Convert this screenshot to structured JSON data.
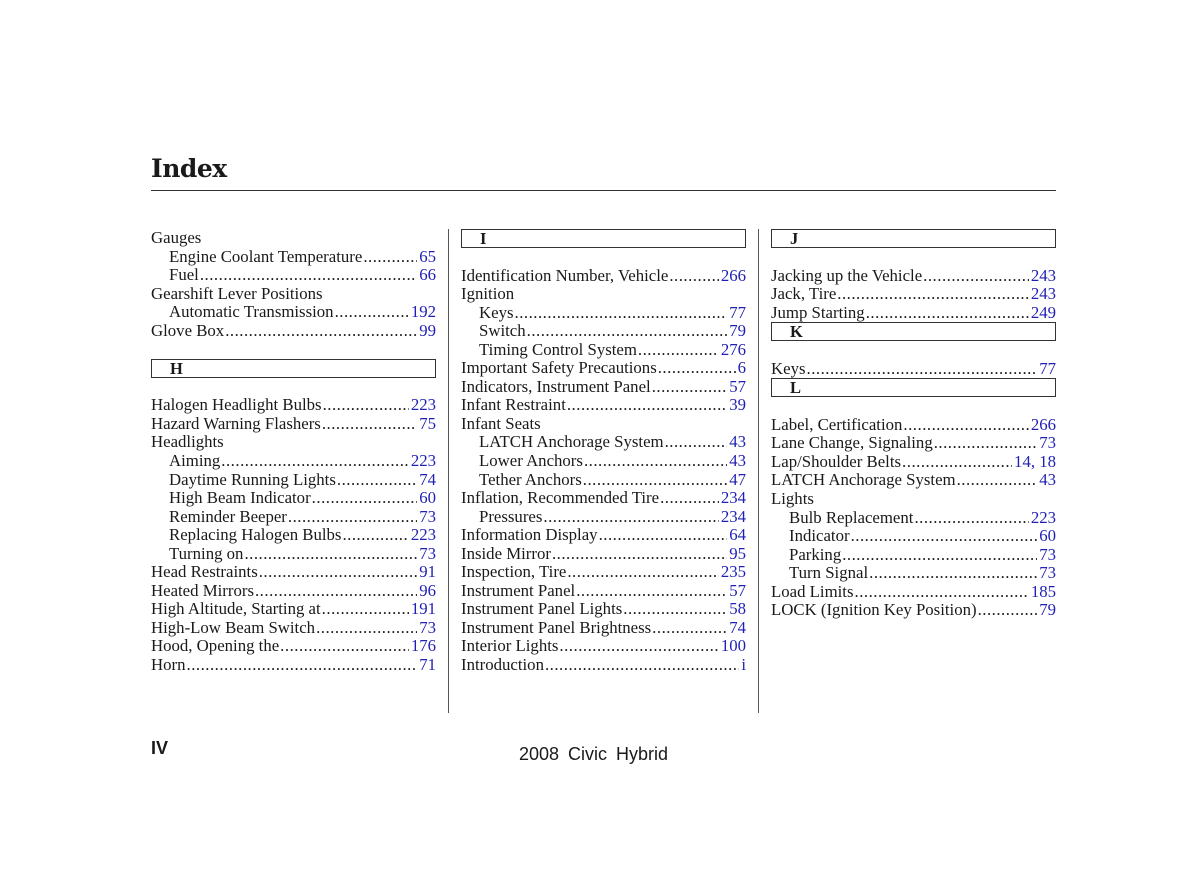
{
  "title": "Index",
  "footer": {
    "page_number": "IV",
    "publication": "2008  Civic  Hybrid"
  },
  "colors": {
    "page_link": "#1f1fb4",
    "text": "#1a1a1a"
  },
  "columns": [
    {
      "blocks": [
        {
          "type": "entry",
          "label": "Gauges",
          "page": "",
          "level": 0
        },
        {
          "type": "entry",
          "label": "Engine Coolant Temperature",
          "page": "65",
          "level": 1
        },
        {
          "type": "entry",
          "label": "Fuel",
          "page": "66",
          "level": 1
        },
        {
          "type": "entry",
          "label": "Gearshift Lever Positions",
          "page": "",
          "level": 0
        },
        {
          "type": "entry",
          "label": "Automatic Transmission",
          "page": "192",
          "level": 1
        },
        {
          "type": "entry",
          "label": "Glove Box",
          "page": "99",
          "level": 0
        },
        {
          "type": "gap"
        },
        {
          "type": "header",
          "letter": "H"
        },
        {
          "type": "entry",
          "label": "Halogen Headlight Bulbs",
          "page": "223",
          "level": 0
        },
        {
          "type": "entry",
          "label": "Hazard Warning Flashers",
          "page": "75",
          "level": 0
        },
        {
          "type": "entry",
          "label": "Headlights",
          "page": "",
          "level": 0
        },
        {
          "type": "entry",
          "label": "Aiming",
          "page": "223",
          "level": 1
        },
        {
          "type": "entry",
          "label": "Daytime Running Lights",
          "page": "74",
          "level": 1
        },
        {
          "type": "entry",
          "label": "High Beam Indicator",
          "page": "60",
          "level": 1
        },
        {
          "type": "entry",
          "label": "Reminder Beeper",
          "page": "73",
          "level": 1
        },
        {
          "type": "entry",
          "label": "Replacing Halogen Bulbs",
          "page": "223",
          "level": 1
        },
        {
          "type": "entry",
          "label": "Turning on",
          "page": "73",
          "level": 1
        },
        {
          "type": "entry",
          "label": "Head Restraints",
          "page": "91",
          "level": 0
        },
        {
          "type": "entry",
          "label": "Heated Mirrors",
          "page": "96",
          "level": 0
        },
        {
          "type": "entry",
          "label": "High Altitude, Starting at",
          "page": "191",
          "level": 0
        },
        {
          "type": "entry",
          "label": "High-Low Beam Switch",
          "page": "73",
          "level": 0
        },
        {
          "type": "entry",
          "label": "Hood, Opening the",
          "page": "176",
          "level": 0
        },
        {
          "type": "entry",
          "label": "Horn",
          "page": "71",
          "level": 0
        }
      ]
    },
    {
      "blocks": [
        {
          "type": "header",
          "letter": "I"
        },
        {
          "type": "entry",
          "label": "Identification Number, Vehicle",
          "page": "266",
          "level": 0
        },
        {
          "type": "entry",
          "label": "Ignition",
          "page": "",
          "level": 0
        },
        {
          "type": "entry",
          "label": "Keys",
          "page": "77",
          "level": 1
        },
        {
          "type": "entry",
          "label": "Switch",
          "page": "79",
          "level": 1
        },
        {
          "type": "entry",
          "label": "Timing Control System",
          "page": "276",
          "level": 1
        },
        {
          "type": "entry",
          "label": "Important Safety Precautions",
          "page": "6",
          "level": 0
        },
        {
          "type": "entry",
          "label": "Indicators, Instrument Panel",
          "page": "57",
          "level": 0
        },
        {
          "type": "entry",
          "label": "Infant Restraint",
          "page": "39",
          "level": 0
        },
        {
          "type": "entry",
          "label": "Infant Seats",
          "page": "",
          "level": 0
        },
        {
          "type": "entry",
          "label": "LATCH Anchorage System",
          "page": "43",
          "level": 1
        },
        {
          "type": "entry",
          "label": "Lower Anchors",
          "page": "43",
          "level": 1
        },
        {
          "type": "entry",
          "label": "Tether Anchors",
          "page": "47",
          "level": 1
        },
        {
          "type": "entry",
          "label": "Inflation, Recommended Tire",
          "page": "234",
          "level": 0
        },
        {
          "type": "entry",
          "label": "Pressures",
          "page": "234",
          "level": 1
        },
        {
          "type": "entry",
          "label": "Information Display",
          "page": "64",
          "level": 0
        },
        {
          "type": "entry",
          "label": "Inside Mirror",
          "page": "95",
          "level": 0
        },
        {
          "type": "entry",
          "label": "Inspection, Tire",
          "page": "235",
          "level": 0
        },
        {
          "type": "entry",
          "label": "Instrument Panel",
          "page": "57",
          "level": 0
        },
        {
          "type": "entry",
          "label": "Instrument Panel Lights",
          "page": "58",
          "level": 0
        },
        {
          "type": "entry",
          "label": "Instrument Panel Brightness",
          "page": "74",
          "level": 0
        },
        {
          "type": "entry",
          "label": "Interior Lights",
          "page": "100",
          "level": 0
        },
        {
          "type": "entry",
          "label": "Introduction",
          "page": "i",
          "level": 0
        }
      ]
    },
    {
      "blocks": [
        {
          "type": "header",
          "letter": "J"
        },
        {
          "type": "entry",
          "label": "Jacking up the Vehicle",
          "page": "243",
          "level": 0
        },
        {
          "type": "entry",
          "label": "Jack, Tire",
          "page": "243",
          "level": 0
        },
        {
          "type": "entry",
          "label": "Jump Starting",
          "page": "249",
          "level": 0
        },
        {
          "type": "header",
          "letter": "K"
        },
        {
          "type": "entry",
          "label": "Keys",
          "page": "77",
          "level": 0
        },
        {
          "type": "header",
          "letter": "L"
        },
        {
          "type": "entry",
          "label": "Label, Certification",
          "page": "266",
          "level": 0
        },
        {
          "type": "entry",
          "label": "Lane Change, Signaling",
          "page": "73",
          "level": 0
        },
        {
          "type": "entry",
          "label": "Lap/Shoulder Belts",
          "page": "14, 18",
          "level": 0
        },
        {
          "type": "entry",
          "label": "LATCH Anchorage System",
          "page": "43",
          "level": 0
        },
        {
          "type": "entry",
          "label": "Lights",
          "page": "",
          "level": 0
        },
        {
          "type": "entry",
          "label": "Bulb Replacement",
          "page": "223",
          "level": 1
        },
        {
          "type": "entry",
          "label": "Indicator",
          "page": "60",
          "level": 1
        },
        {
          "type": "entry",
          "label": "Parking",
          "page": "73",
          "level": 1
        },
        {
          "type": "entry",
          "label": "Turn Signal",
          "page": "73",
          "level": 1
        },
        {
          "type": "entry",
          "label": "Load Limits",
          "page": "185",
          "level": 0
        },
        {
          "type": "entry",
          "label": "LOCK (Ignition Key Position)",
          "page": "79",
          "level": 0
        }
      ]
    }
  ]
}
